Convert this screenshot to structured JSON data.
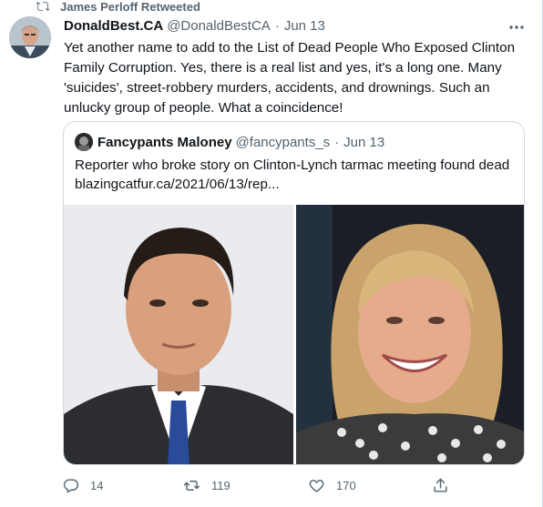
{
  "retweet_banner": {
    "text": "James Perloff Retweeted"
  },
  "tweet": {
    "author_name": "DonaldBest.CA",
    "author_handle": "@DonaldBestCA",
    "separator": "·",
    "date": "Jun 13",
    "text": "Yet another name to add to the List of Dead People Who Exposed Clinton Family Corruption. Yes, there is a real list and yes, it's a long one. Many 'suicides', street-robbery murders, accidents, and drownings. Such an unlucky group of people. What a coincidence!"
  },
  "quoted_tweet": {
    "author_name": "Fancypants Maloney",
    "author_handle": "@fancypants_s",
    "separator": "·",
    "date": "Jun 13",
    "text": "Reporter who broke story on Clinton-Lynch tarmac meeting found dead",
    "link": "blazingcatfur.ca/2021/06/13/rep..."
  },
  "actions": {
    "reply_count": "14",
    "retweet_count": "119",
    "like_count": "170"
  },
  "icons": {
    "retweet": "retweet-icon",
    "more": "more-icon",
    "reply": "reply-icon",
    "like": "heart-icon",
    "share": "share-icon"
  },
  "colors": {
    "text_primary": "#0f1419",
    "text_secondary": "#536471",
    "border": "#cfd9de"
  }
}
